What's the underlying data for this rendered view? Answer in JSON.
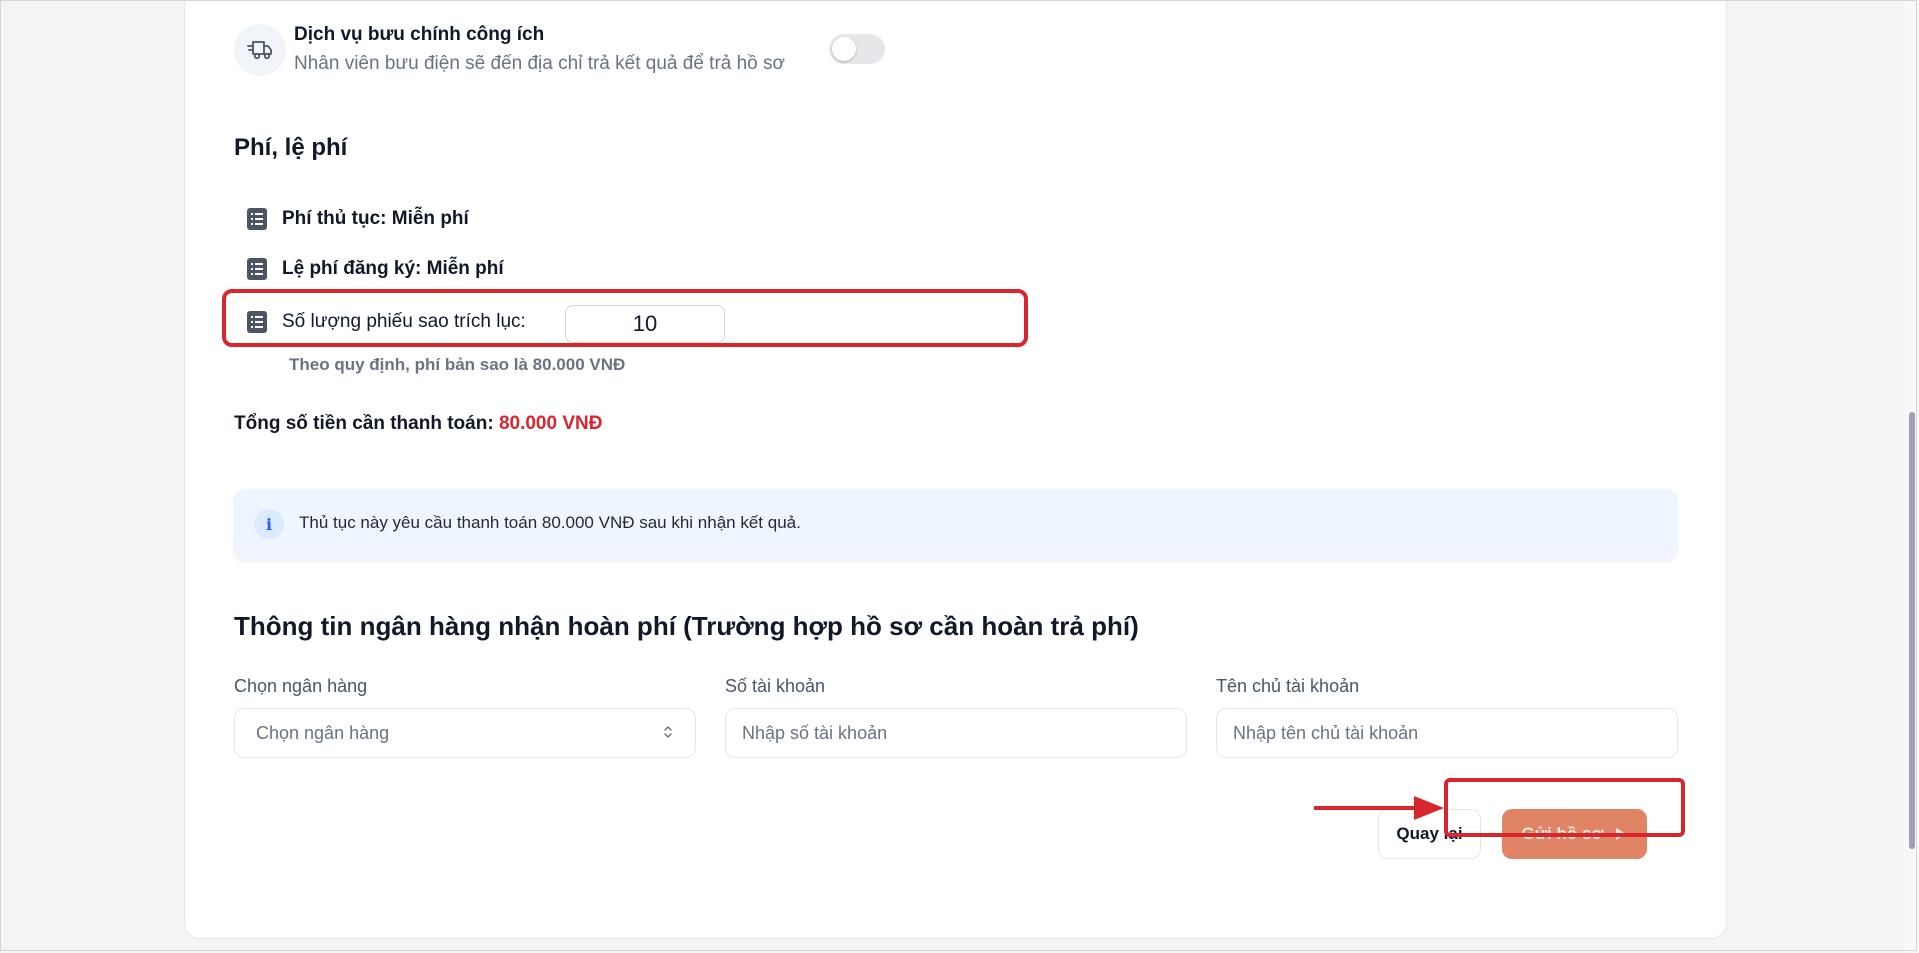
{
  "postal_service": {
    "title": "Dịch vụ bưu chính công ích",
    "description": "Nhân viên bưu điện sẽ đến địa chỉ trả kết quả để trả hồ sơ",
    "icon": "truck-icon",
    "enabled": false
  },
  "fees": {
    "heading": "Phí, lệ phí",
    "procedure_fee": "Phí thủ tục: Miễn phí",
    "registration_fee": "Lệ phí đăng ký: Miễn phí",
    "copy_quantity_label": "Số lượng phiếu sao trích lục:",
    "copy_quantity_value": "10",
    "note": "Theo quy định, phí bản sao là 80.000 VNĐ",
    "total_label": "Tổng số tiền cần thanh toán:",
    "total_amount": "80.000 VNĐ",
    "icon": "receipt-icon"
  },
  "info_notice": {
    "icon": "i",
    "text": "Thủ tục này yêu cầu thanh toán 80.000 VNĐ sau khi nhận kết quả."
  },
  "bank": {
    "heading": "Thông tin ngân hàng nhận hoàn phí (Trường hợp hồ sơ cần hoàn trả phí)",
    "bank_select_label": "Chọn ngân hàng",
    "bank_select_value": "Chọn ngân hàng",
    "account_number_label": "Số tài khoản",
    "account_number_placeholder": "Nhập số tài khoản",
    "account_name_label": "Tên chủ tài khoản",
    "account_name_placeholder": "Nhập tên chủ tài khoản"
  },
  "actions": {
    "back_label": "Quay lại",
    "submit_label": "Gửi hồ sơ",
    "submit_icon": "send-icon"
  },
  "colors": {
    "accent_red": "#d7262e",
    "submit_bg": "#e08466",
    "info_bg": "#eff6ff"
  }
}
